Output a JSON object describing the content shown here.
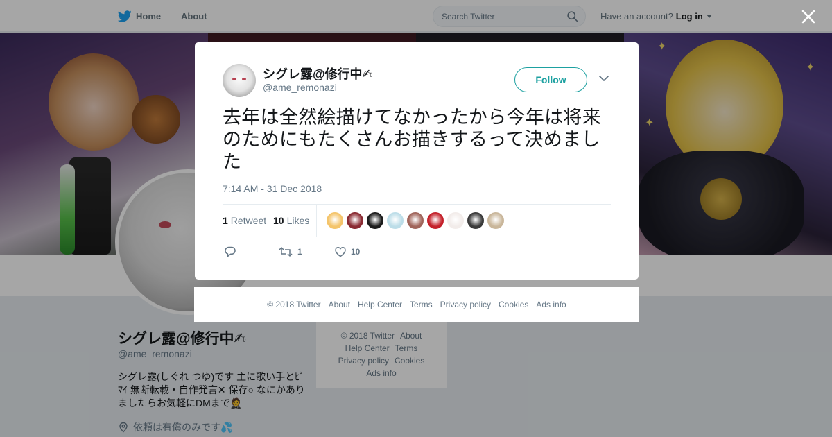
{
  "nav": {
    "home_label": "Home",
    "about_label": "About",
    "search_placeholder": "Search Twitter",
    "account_prompt": "Have an account?",
    "login_label": "Log in"
  },
  "colors": {
    "brand": "#1da1f2",
    "follow": "#1da1a1",
    "text": "#14171a",
    "muted": "#657786"
  },
  "profile": {
    "name": "シグレ露@修行中✍",
    "handle": "@ame_remonazi",
    "bio": "シグレ露(しぐれ つゆ)です 主に歌い手とﾋﾟﾏｲ 無断転載・自作発言✕ 保存○ なにかありましたらお気軽にDMまで🤵",
    "location": "依頼は有償のみです💦"
  },
  "side_footer": {
    "copyright": "© 2018 Twitter",
    "about": "About",
    "help": "Help Center",
    "terms": "Terms",
    "privacy": "Privacy policy",
    "cookies": "Cookies",
    "ads": "Ads info"
  },
  "tweet": {
    "author_name": "シグレ露@修行中✍",
    "author_handle": "@ame_remonazi",
    "follow_label": "Follow",
    "text": "去年は全然絵描けてなかったから今年は将来のためにもたくさんお描きするって決めました",
    "timestamp": "7:14 AM - 31 Dec 2018",
    "retweet_count": "1",
    "retweet_label": "Retweet",
    "like_count": "10",
    "like_label": "Likes",
    "action_retweet_count": "1",
    "action_like_count": "10",
    "liker_colors": [
      "#f4c46a",
      "#8a2a32",
      "#1c1c1c",
      "#bcdde8",
      "#a0645a",
      "#c4202a",
      "#f2ecea",
      "#3a3a3a",
      "#c9b69a"
    ]
  },
  "modal_footer": {
    "copyright": "© 2018 Twitter",
    "about": "About",
    "help": "Help Center",
    "terms": "Terms",
    "privacy": "Privacy policy",
    "cookies": "Cookies",
    "ads": "Ads info"
  },
  "icons": {
    "nav_logo": "twitter-bird-icon",
    "search": "search-icon",
    "close": "close-icon",
    "menu": "chevron-down-icon",
    "reply": "reply-icon",
    "retweet": "retweet-icon",
    "like": "heart-icon",
    "location": "location-pin-icon"
  }
}
